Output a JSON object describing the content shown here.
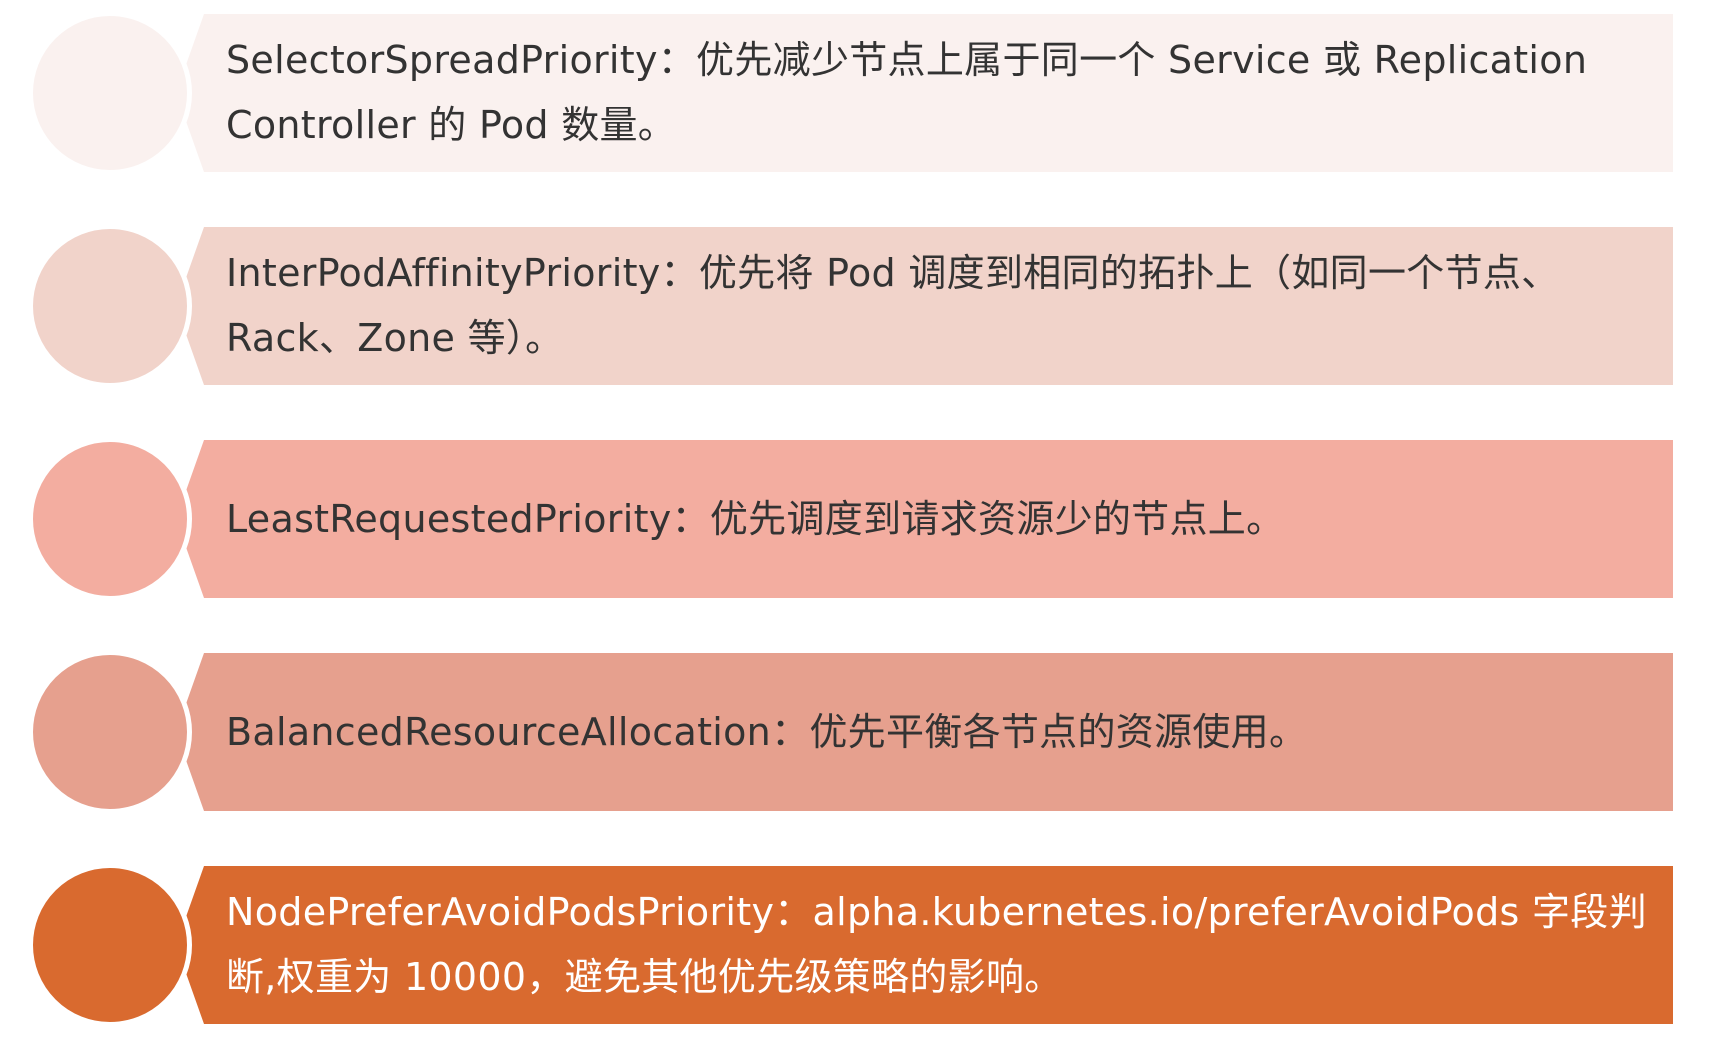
{
  "items": [
    {
      "text": "SelectorSpreadPriority：优先减少节点上属于同一个 Service 或 Replication Controller 的 Pod 数量。",
      "bar_color": "#faf1ef",
      "circle_color": "#faf1ef",
      "text_color": "#333333"
    },
    {
      "text": "InterPodAffinityPriority：优先将 Pod 调度到相同的拓扑上（如同一个节点、Rack、Zone 等）。",
      "bar_color": "#f1d3ca",
      "circle_color": "#f1d3ca",
      "text_color": "#333333"
    },
    {
      "text": "LeastRequestedPriority：优先调度到请求资源少的节点上。",
      "bar_color": "#f3ada0",
      "circle_color": "#f3ada0",
      "text_color": "#333333"
    },
    {
      "text": "BalancedResourceAllocation：优先平衡各节点的资源使用。",
      "bar_color": "#e6a08e",
      "circle_color": "#e6a08e",
      "text_color": "#333333"
    },
    {
      "text": "NodePreferAvoidPodsPriority：alpha.kubernetes.io/preferAvoidPods 字段判断,权重为 10000，避免其他优先级策略的影响。",
      "bar_color": "#d96a2f",
      "circle_color": "#d96a2f",
      "text_color": "#ffffff"
    }
  ]
}
